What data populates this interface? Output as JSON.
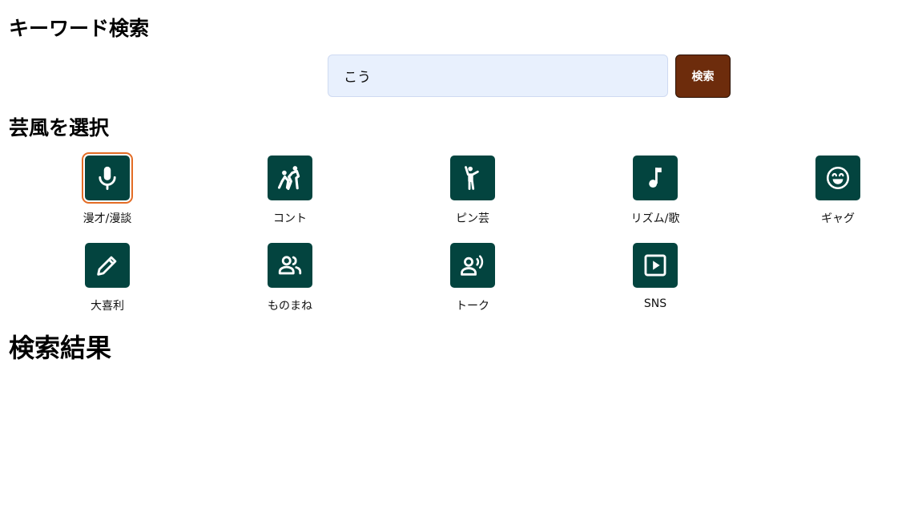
{
  "keyword_section": {
    "heading": "キーワード検索",
    "input_value": "こう",
    "search_button_label": "検索"
  },
  "style_section": {
    "heading": "芸風を選択",
    "selected": "漫才/漫談",
    "items": [
      {
        "label": "漫才/漫談",
        "icon": "microphone-icon"
      },
      {
        "label": "コント",
        "icon": "sports-kabaddi-icon"
      },
      {
        "label": "ピン芸",
        "icon": "man-waving-icon"
      },
      {
        "label": "リズム/歌",
        "icon": "music-note-icon"
      },
      {
        "label": "ギャグ",
        "icon": "laughing-face-icon"
      },
      {
        "label": "大喜利",
        "icon": "pencil-icon"
      },
      {
        "label": "ものまね",
        "icon": "two-people-icon"
      },
      {
        "label": "トーク",
        "icon": "person-speaking-icon"
      },
      {
        "label": "SNS",
        "icon": "play-square-icon"
      }
    ]
  },
  "results_section": {
    "heading": "検索結果"
  },
  "colors": {
    "tile": "#03443f",
    "selected_outline": "#e36c25",
    "search_button": "#6d2c0c",
    "input_background": "#e8f0fd"
  }
}
